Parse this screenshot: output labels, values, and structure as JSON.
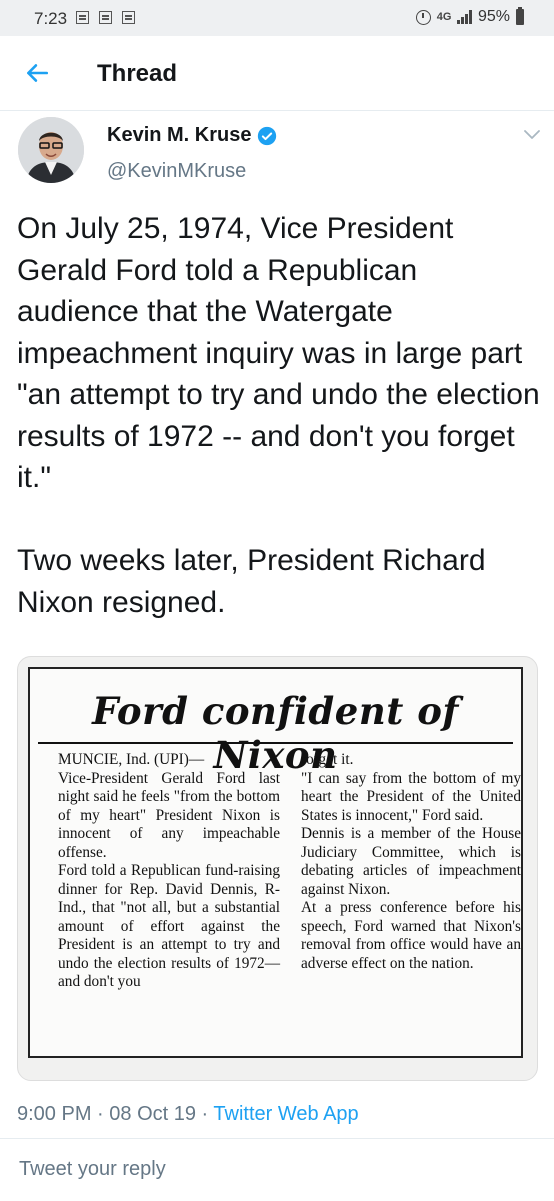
{
  "status_bar": {
    "time": "7:23",
    "network": "4G",
    "battery": "95%",
    "notification_icons": [
      "notification-icon",
      "notification-icon",
      "notification-icon"
    ]
  },
  "header": {
    "title": "Thread",
    "back_icon": "arrow-left-icon"
  },
  "tweet": {
    "author_name": "Kevin M. Kruse",
    "author_handle": "@KevinMKruse",
    "text": "On July 25, 1974, Vice President Gerald Ford told a Republican audience that the Watergate impeachment inquiry was in large part \"an attempt to try and undo the election results of 1972 -- and don't you forget it.\"\n\nTwo weeks later, President Richard Nixon resigned.",
    "clipping": {
      "headline": "Ford confident of Nixon",
      "column_left": "MUNCIE, Ind. (UPI)—\nVice-President Gerald Ford last night said he feels \"from the bottom of my heart\" President Nixon is innocent of any impeachable offense.\nFord told a Republican fund-raising dinner for Rep. David Dennis, R-Ind., that \"not all, but a substantial amount of effort against the President is an attempt to try and undo the election results of 1972—and don't you",
      "column_right": "forget it.\n\"I can say from the bottom of my heart the President of the United States is innocent,\" Ford said.\nDennis is a member of the House Judiciary Committee, which is debating articles of impeachment against Nixon.\nAt a press conference before his speech, Ford warned that Nixon's removal from office would have an adverse effect on the nation."
    },
    "time": "9:00 PM",
    "date": "08 Oct 19",
    "source": "Twitter Web App"
  },
  "reply": {
    "placeholder": "Tweet your reply"
  },
  "colors": {
    "accent": "#1da1f2",
    "secondary_text": "#657786",
    "primary_text": "#14171a"
  }
}
